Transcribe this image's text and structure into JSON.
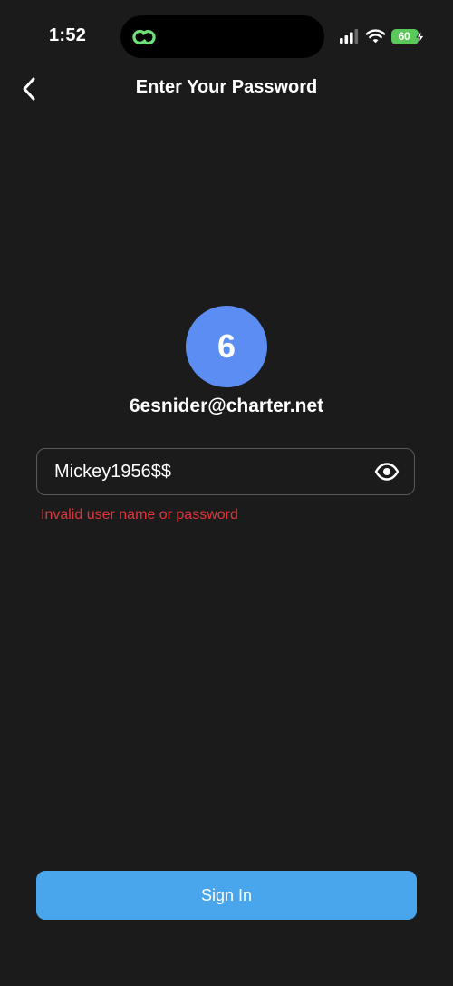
{
  "status_bar": {
    "time": "1:52",
    "battery": "60",
    "island_icon": "linked-rings-icon"
  },
  "header": {
    "back_icon": "chevron-left-icon",
    "title": "Enter Your Password"
  },
  "account": {
    "avatar_initial": "6",
    "email": "6esnider@charter.net",
    "avatar_color": "#5b8df3"
  },
  "password": {
    "value": "Mickey1956$$",
    "toggle_icon": "eye-icon",
    "error": "Invalid user name or password"
  },
  "actions": {
    "sign_in_label": "Sign In",
    "button_color": "#4aa6ec"
  },
  "colors": {
    "background": "#1b1b1c",
    "error": "#e0363b",
    "battery": "#5ac85a"
  }
}
